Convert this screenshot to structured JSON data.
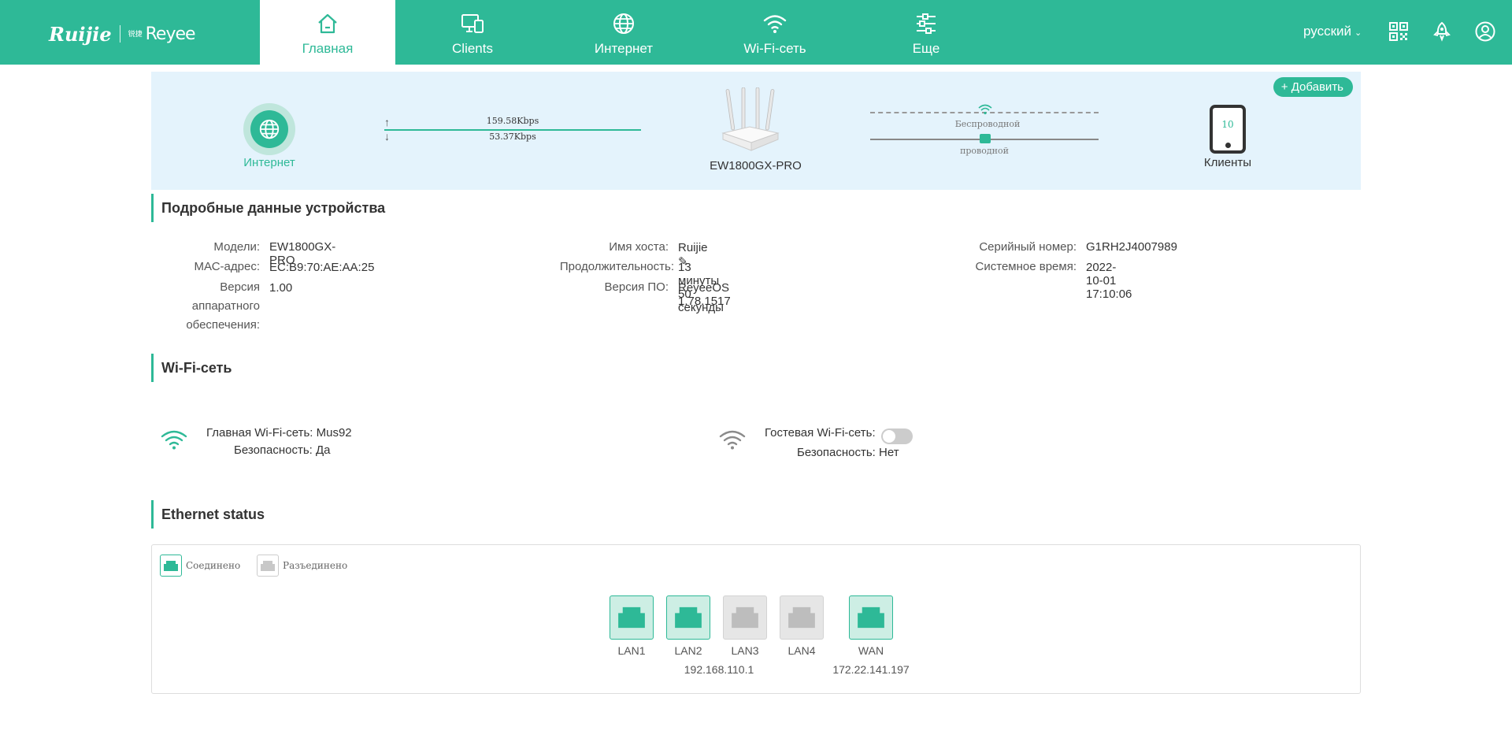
{
  "header": {
    "logo_primary": "Ruijie",
    "logo_secondary": "Reyee",
    "logo_small": "锐捷",
    "nav": [
      {
        "label": "Главная",
        "icon": "home-icon",
        "active": true
      },
      {
        "label": "Clients",
        "icon": "devices-icon",
        "active": false
      },
      {
        "label": "Интернет",
        "icon": "globe-icon",
        "active": false
      },
      {
        "label": "Wi-Fi-сеть",
        "icon": "wifi-icon",
        "active": false
      },
      {
        "label": "Еще",
        "icon": "settings-sliders-icon",
        "active": false
      }
    ],
    "language": "русский",
    "icons": [
      "qr-code-icon",
      "rocket-icon",
      "user-icon"
    ]
  },
  "banner": {
    "add_button": "+ Добавить",
    "internet_label": "Интернет",
    "upload_rate": "159.58Kbps",
    "download_rate": "53.37Kbps",
    "device_model": "EW1800GX-PRO",
    "wireless_label": "Беспроводной",
    "wired_label": "проводной",
    "clients_count": "10",
    "clients_label": "Клиенты"
  },
  "device_details": {
    "title": "Подробные данные устройства",
    "model_key": "Модели:",
    "model_val": "EW1800GX-PRO",
    "mac_key": "МАС-адрес:",
    "mac_val": "EC:B9:70:AE:AA:25",
    "hw_key_1": "Версия",
    "hw_key_2": "аппаратного",
    "hw_key_3": "обеспечения:",
    "hw_val": "1.00",
    "host_key": "Имя хоста:",
    "host_val": "Ruijie",
    "uptime_key": "Продолжительность:",
    "uptime_val": "13 минуты 50 секунды",
    "fw_key": "Версия ПО:",
    "fw_val": "ReyeeOS 1.78.1517",
    "serial_key": "Серийный номер:",
    "serial_val": "G1RH2J4007989",
    "systime_key": "Системное время:",
    "systime_val": "2022-10-01 17:10:06"
  },
  "wifi": {
    "title": "Wi-Fi-сеть",
    "main_label": "Главная Wi-Fi-сеть:",
    "main_ssid": "Mus92",
    "main_security": "Безопасность: Да",
    "guest_label": "Гостевая Wi-Fi-сеть:",
    "guest_enabled": false,
    "guest_security": "Безопасность: Нет"
  },
  "ethernet": {
    "title": "Ethernet status",
    "legend_connected": "Соединено",
    "legend_disconnected": "Разъединено",
    "ports": [
      {
        "label": "LAN1",
        "connected": true
      },
      {
        "label": "LAN2",
        "connected": true
      },
      {
        "label": "LAN3",
        "connected": false
      },
      {
        "label": "LAN4",
        "connected": false
      },
      {
        "label": "WAN",
        "connected": true
      }
    ],
    "lan_ip": "192.168.110.1",
    "wan_ip": "172.22.141.197"
  },
  "colors": {
    "accent": "#2eb997",
    "banner_bg": "#e4f3fc",
    "port_off": "#e6e6e6"
  }
}
